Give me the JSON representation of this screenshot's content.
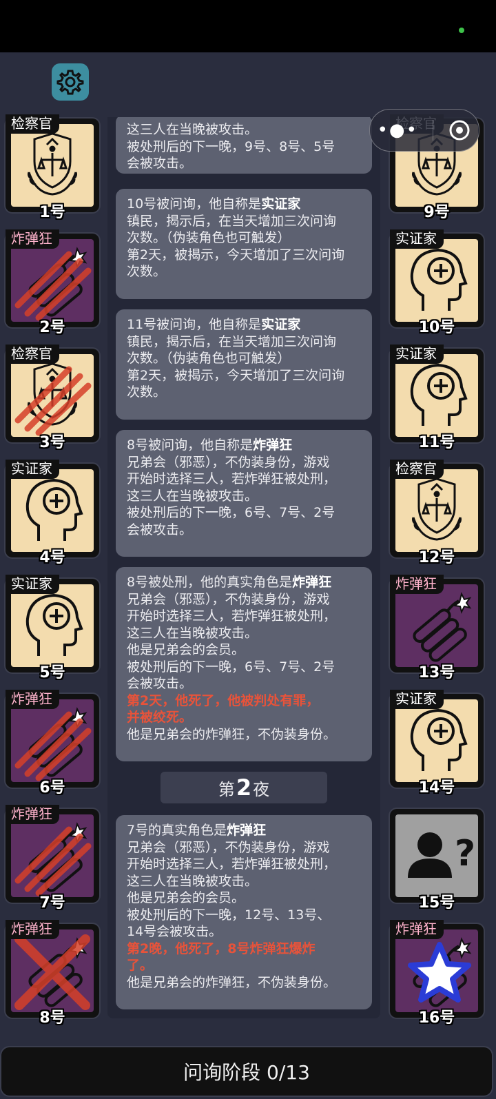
{
  "colors": {
    "background": "#2a2d3e",
    "card_beige": "#f3dcae",
    "card_purple": "#5e2f62",
    "message_bg": "#5d6171",
    "highlight_red": "#e8533a",
    "settings_teal": "#3d8ea0"
  },
  "header": {
    "settings_icon": "gear-icon",
    "capsule_icons": [
      "more-dots-icon",
      "close-circle-icon"
    ]
  },
  "left_players": [
    {
      "role": "检察官",
      "number": "1号",
      "art": "prosecutor",
      "status": ""
    },
    {
      "role": "炸弹狂",
      "number": "2号",
      "art": "bomb",
      "status": "claw"
    },
    {
      "role": "检察官",
      "number": "3号",
      "art": "prosecutor",
      "status": "claw"
    },
    {
      "role": "实证家",
      "number": "4号",
      "art": "head",
      "status": ""
    },
    {
      "role": "实证家",
      "number": "5号",
      "art": "head",
      "status": ""
    },
    {
      "role": "炸弹狂",
      "number": "6号",
      "art": "bomb",
      "status": "claw"
    },
    {
      "role": "炸弹狂",
      "number": "7号",
      "art": "bomb",
      "status": "claw"
    },
    {
      "role": "炸弹狂",
      "number": "8号",
      "art": "bomb",
      "status": "cross"
    }
  ],
  "right_players": [
    {
      "role": "检察官",
      "number": "9号",
      "art": "prosecutor",
      "status": ""
    },
    {
      "role": "实证家",
      "number": "10号",
      "art": "head",
      "status": ""
    },
    {
      "role": "实证家",
      "number": "11号",
      "art": "head",
      "status": ""
    },
    {
      "role": "检察官",
      "number": "12号",
      "art": "prosecutor",
      "status": ""
    },
    {
      "role": "炸弹狂",
      "number": "13号",
      "art": "bomb",
      "status": ""
    },
    {
      "role": "实证家",
      "number": "14号",
      "art": "head",
      "status": ""
    },
    {
      "role": "",
      "number": "15号",
      "art": "unknown",
      "status": ""
    },
    {
      "role": "炸弹狂",
      "number": "16号",
      "art": "bomb",
      "status": "star"
    }
  ],
  "log": {
    "messages": [
      {
        "segments": [
          {
            "t": "这三人在当晚被攻击。\n被处刑后的下一晚，9号、8号、5号\n会被攻击。"
          }
        ]
      },
      {
        "segments": [
          {
            "t": "10号被问询，他自称是"
          },
          {
            "t": "实证家",
            "b": true
          },
          {
            "t": "\n镇民，揭示后，在当天增加三次问询\n次数。（伪装角色也可触发）\n第2天，被揭示，今天增加了三次问询\n次数。"
          }
        ]
      },
      {
        "segments": [
          {
            "t": "11号被问询，他自称是"
          },
          {
            "t": "实证家",
            "b": true
          },
          {
            "t": "\n镇民，揭示后，在当天增加三次问询\n次数。（伪装角色也可触发）\n第2天，被揭示，今天增加了三次问询\n次数。"
          }
        ]
      },
      {
        "segments": [
          {
            "t": "8号被问询，他自称是"
          },
          {
            "t": "炸弹狂",
            "b": true
          },
          {
            "t": "\n兄弟会（邪恶），不伪装身份，游戏\n开始时选择三人，若炸弹狂被处刑，\n这三人在当晚被攻击。\n被处刑后的下一晚，6号、7号、2号\n会被攻击。"
          }
        ]
      },
      {
        "segments": [
          {
            "t": "8号被处刑，他的真实角色是"
          },
          {
            "t": "炸弹狂",
            "b": true
          },
          {
            "t": "\n兄弟会（邪恶），不伪装身份，游戏\n开始时选择三人，若炸弹狂被处刑，\n这三人在当晚被攻击。\n他是兄弟会的会员。\n被处刑后的下一晚，6号、7号、2号\n会被攻击。\n"
          },
          {
            "t": "第2天，他死了，他被判处有罪，\n并被绞死。",
            "r": true
          },
          {
            "t": "\n他是兄弟会的炸弹狂，不伪装身份。"
          }
        ]
      },
      {
        "segments": [
          {
            "t": "7号的真实角色是"
          },
          {
            "t": "炸弹狂",
            "b": true
          },
          {
            "t": "\n兄弟会（邪恶），不伪装身份，游戏\n开始时选择三人，若炸弹狂被处刑，\n这三人在当晚被攻击。\n他是兄弟会的会员。\n被处刑后的下一晚，12号、13号、\n14号会被攻击。\n"
          },
          {
            "t": "第2晚，他死了，8号炸弹狂爆炸\n了。",
            "r": true
          },
          {
            "t": "\n他是兄弟会的炸弹狂，不伪装身份。"
          }
        ]
      }
    ],
    "night_divider": {
      "prefix": "第",
      "number": "2",
      "suffix": "夜"
    }
  },
  "footer": {
    "phase_label": "问询阶段 0/13"
  }
}
